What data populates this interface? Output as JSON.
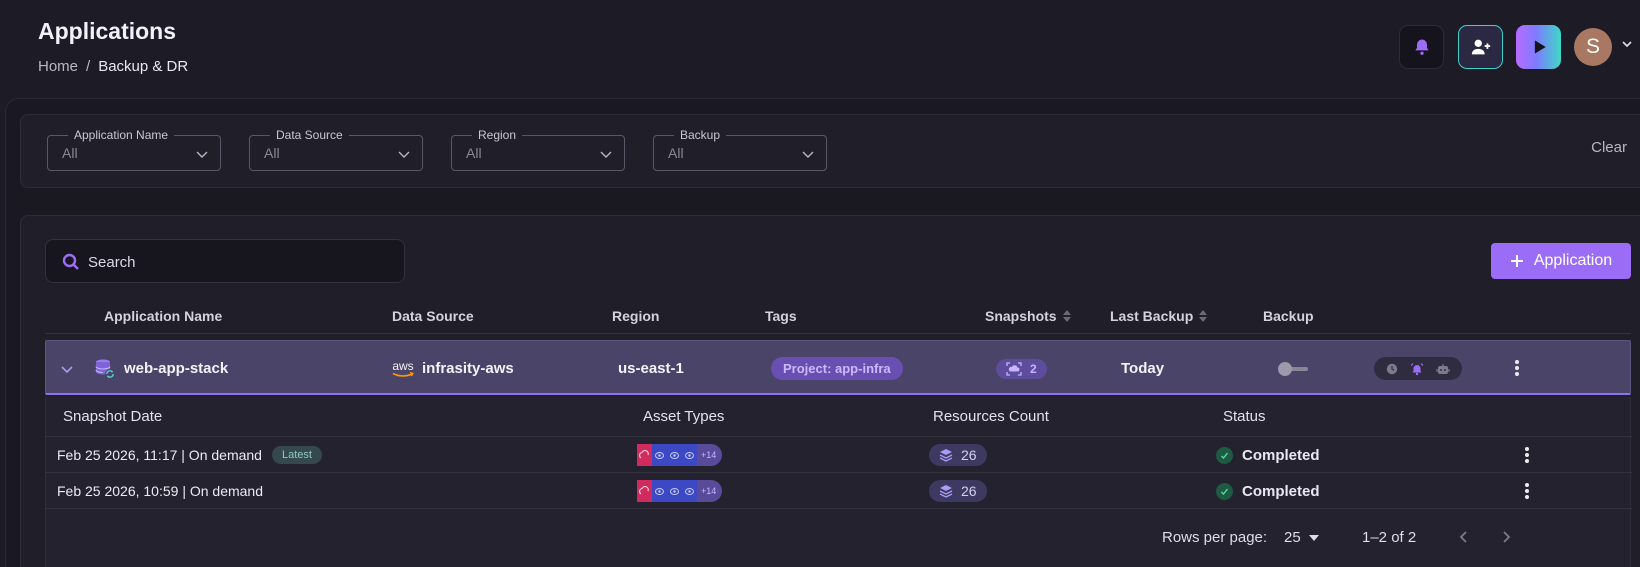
{
  "header": {
    "title": "Applications",
    "breadcrumb": [
      {
        "label": "Home"
      },
      {
        "label": "Backup & DR"
      }
    ],
    "avatar_initial": "S"
  },
  "filters": {
    "application_name": {
      "label": "Application Name",
      "value": "All"
    },
    "data_source": {
      "label": "Data Source",
      "value": "All"
    },
    "region": {
      "label": "Region",
      "value": "All"
    },
    "backup": {
      "label": "Backup",
      "value": "All"
    },
    "clear_label": "Clear"
  },
  "toolbar": {
    "search_placeholder": "Search",
    "add_button_label": "Application"
  },
  "table": {
    "columns": [
      "Application Name",
      "Data Source",
      "Region",
      "Tags",
      "Snapshots",
      "Last Backup",
      "Backup"
    ],
    "rows": [
      {
        "name": "web-app-stack",
        "data_source": "infrasity-aws",
        "data_source_logo": "aws",
        "region": "us-east-1",
        "tag": "Project: app-infra",
        "snapshots": "2",
        "last_backup": "Today",
        "backup_enabled": false
      }
    ]
  },
  "snapshots_table": {
    "columns": [
      "Snapshot Date",
      "Asset Types",
      "Resources Count",
      "Status"
    ],
    "rows": [
      {
        "date": "Feb 25 2026, 11:17 | On demand",
        "badge": "Latest",
        "assets_more": "+14",
        "resources": "26",
        "status": "Completed"
      },
      {
        "date": "Feb 25 2026, 10:59 | On demand",
        "badge": "",
        "assets_more": "+14",
        "resources": "26",
        "status": "Completed"
      }
    ]
  },
  "pagination": {
    "rows_per_page_label": "Rows per page:",
    "rows_per_page_value": "25",
    "range_label": "1–2 of 2"
  },
  "colors": {
    "accent": "#9b6cf6",
    "row_highlight": "#4a4468",
    "status_completed": "#2fbf86"
  }
}
